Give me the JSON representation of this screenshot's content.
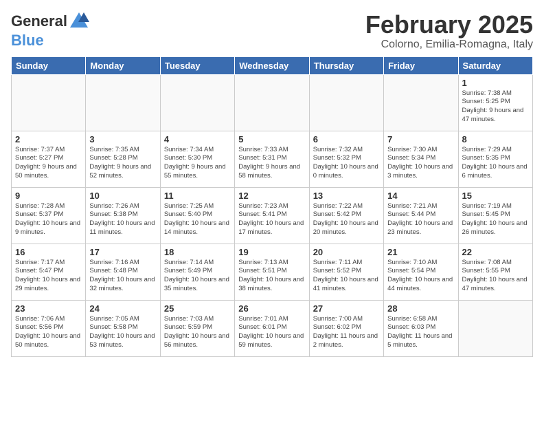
{
  "header": {
    "logo_general": "General",
    "logo_blue": "Blue",
    "month_title": "February 2025",
    "location": "Colorno, Emilia-Romagna, Italy"
  },
  "days_of_week": [
    "Sunday",
    "Monday",
    "Tuesday",
    "Wednesday",
    "Thursday",
    "Friday",
    "Saturday"
  ],
  "weeks": [
    [
      {
        "day": "",
        "empty": true
      },
      {
        "day": "",
        "empty": true
      },
      {
        "day": "",
        "empty": true
      },
      {
        "day": "",
        "empty": true
      },
      {
        "day": "",
        "empty": true
      },
      {
        "day": "",
        "empty": true
      },
      {
        "day": "1",
        "sunrise": "7:38 AM",
        "sunset": "5:25 PM",
        "daylight": "9 hours and 47 minutes."
      }
    ],
    [
      {
        "day": "2",
        "sunrise": "7:37 AM",
        "sunset": "5:27 PM",
        "daylight": "9 hours and 50 minutes."
      },
      {
        "day": "3",
        "sunrise": "7:35 AM",
        "sunset": "5:28 PM",
        "daylight": "9 hours and 52 minutes."
      },
      {
        "day": "4",
        "sunrise": "7:34 AM",
        "sunset": "5:30 PM",
        "daylight": "9 hours and 55 minutes."
      },
      {
        "day": "5",
        "sunrise": "7:33 AM",
        "sunset": "5:31 PM",
        "daylight": "9 hours and 58 minutes."
      },
      {
        "day": "6",
        "sunrise": "7:32 AM",
        "sunset": "5:32 PM",
        "daylight": "10 hours and 0 minutes."
      },
      {
        "day": "7",
        "sunrise": "7:30 AM",
        "sunset": "5:34 PM",
        "daylight": "10 hours and 3 minutes."
      },
      {
        "day": "8",
        "sunrise": "7:29 AM",
        "sunset": "5:35 PM",
        "daylight": "10 hours and 6 minutes."
      }
    ],
    [
      {
        "day": "9",
        "sunrise": "7:28 AM",
        "sunset": "5:37 PM",
        "daylight": "10 hours and 9 minutes."
      },
      {
        "day": "10",
        "sunrise": "7:26 AM",
        "sunset": "5:38 PM",
        "daylight": "10 hours and 11 minutes."
      },
      {
        "day": "11",
        "sunrise": "7:25 AM",
        "sunset": "5:40 PM",
        "daylight": "10 hours and 14 minutes."
      },
      {
        "day": "12",
        "sunrise": "7:23 AM",
        "sunset": "5:41 PM",
        "daylight": "10 hours and 17 minutes."
      },
      {
        "day": "13",
        "sunrise": "7:22 AM",
        "sunset": "5:42 PM",
        "daylight": "10 hours and 20 minutes."
      },
      {
        "day": "14",
        "sunrise": "7:21 AM",
        "sunset": "5:44 PM",
        "daylight": "10 hours and 23 minutes."
      },
      {
        "day": "15",
        "sunrise": "7:19 AM",
        "sunset": "5:45 PM",
        "daylight": "10 hours and 26 minutes."
      }
    ],
    [
      {
        "day": "16",
        "sunrise": "7:17 AM",
        "sunset": "5:47 PM",
        "daylight": "10 hours and 29 minutes."
      },
      {
        "day": "17",
        "sunrise": "7:16 AM",
        "sunset": "5:48 PM",
        "daylight": "10 hours and 32 minutes."
      },
      {
        "day": "18",
        "sunrise": "7:14 AM",
        "sunset": "5:49 PM",
        "daylight": "10 hours and 35 minutes."
      },
      {
        "day": "19",
        "sunrise": "7:13 AM",
        "sunset": "5:51 PM",
        "daylight": "10 hours and 38 minutes."
      },
      {
        "day": "20",
        "sunrise": "7:11 AM",
        "sunset": "5:52 PM",
        "daylight": "10 hours and 41 minutes."
      },
      {
        "day": "21",
        "sunrise": "7:10 AM",
        "sunset": "5:54 PM",
        "daylight": "10 hours and 44 minutes."
      },
      {
        "day": "22",
        "sunrise": "7:08 AM",
        "sunset": "5:55 PM",
        "daylight": "10 hours and 47 minutes."
      }
    ],
    [
      {
        "day": "23",
        "sunrise": "7:06 AM",
        "sunset": "5:56 PM",
        "daylight": "10 hours and 50 minutes."
      },
      {
        "day": "24",
        "sunrise": "7:05 AM",
        "sunset": "5:58 PM",
        "daylight": "10 hours and 53 minutes."
      },
      {
        "day": "25",
        "sunrise": "7:03 AM",
        "sunset": "5:59 PM",
        "daylight": "10 hours and 56 minutes."
      },
      {
        "day": "26",
        "sunrise": "7:01 AM",
        "sunset": "6:01 PM",
        "daylight": "10 hours and 59 minutes."
      },
      {
        "day": "27",
        "sunrise": "7:00 AM",
        "sunset": "6:02 PM",
        "daylight": "11 hours and 2 minutes."
      },
      {
        "day": "28",
        "sunrise": "6:58 AM",
        "sunset": "6:03 PM",
        "daylight": "11 hours and 5 minutes."
      },
      {
        "day": "",
        "empty": true
      }
    ]
  ]
}
